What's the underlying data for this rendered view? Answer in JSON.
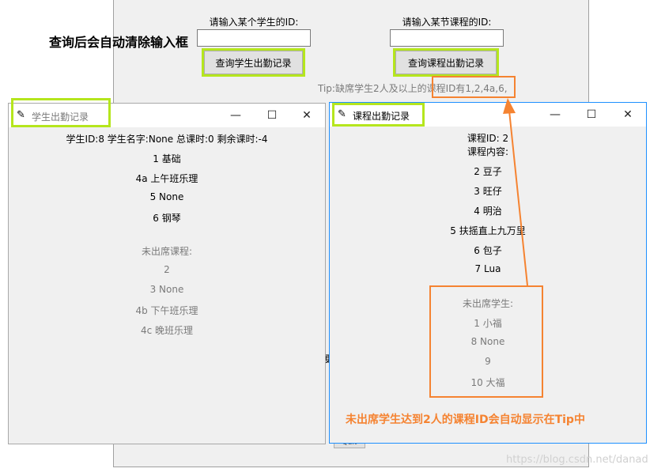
{
  "main": {
    "heading": "查询后会自动清除输入框",
    "student_id_label": "请输入某个学生的ID:",
    "course_id_label": "请输入某节课程的ID:",
    "student_query_button": "查询学生出勤记录",
    "course_query_button": "查询课程出勤记录",
    "tip": "Tip:缺席学生2人及以上的课程ID有1,2,4a,6,",
    "partial_glyph": "更",
    "bottom_partial_button": "Quit"
  },
  "student_window": {
    "title": "学生出勤记录",
    "summary": "学生ID:8  学生名字:None  总课时:0  剩余课时:-4",
    "attended": [
      "1 基础",
      "4a 上午班乐理",
      "5 None",
      "6 钢琴"
    ],
    "absent_header": "未出席课程:",
    "absent": [
      "2",
      "3 None",
      "4b 下午班乐理",
      "4c 晚班乐理"
    ]
  },
  "course_window": {
    "title": "课程出勤记录",
    "course_id": "课程ID:  2",
    "course_content": "课程内容:",
    "attended": [
      "2  豆子",
      "3  旺仔",
      "4  明治",
      "5  扶摇直上九万里",
      "6  包子",
      "7  Lua"
    ],
    "absent_header": "未出席学生:",
    "absent": [
      "1  小福",
      "8  None",
      "9",
      "10  大福"
    ]
  },
  "window_controls": {
    "minimize": "—",
    "maximize": "☐",
    "close": "✕"
  },
  "annotation": "未出席学生达到2人的课程ID会自动显示在Tip中",
  "watermark": "https://blog.csdn.net/danad",
  "colors": {
    "highlight_green": "#b5e61d",
    "annotation_orange": "#f58331",
    "active_border": "#1e90ff"
  },
  "icons": [
    "feather-icon",
    "minimize-icon",
    "maximize-icon",
    "close-icon"
  ]
}
